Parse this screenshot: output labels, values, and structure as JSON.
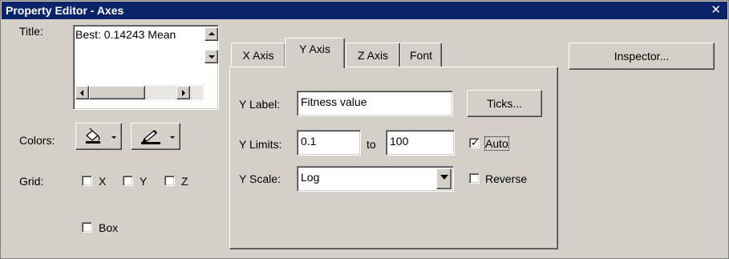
{
  "window": {
    "title": "Property Editor - Axes",
    "close_glyph": "✕",
    "titlebar_color": "#0a246a"
  },
  "left": {
    "title_label": "Title:",
    "title_value": "Best: 0.14243 Mean",
    "colors_label": "Colors:",
    "fill_color_icon": "paint-bucket-icon",
    "edge_color_icon": "pen-icon",
    "grid_label": "Grid:",
    "grid_options": [
      {
        "label": "X",
        "checked": false
      },
      {
        "label": "Y",
        "checked": false
      },
      {
        "label": "Z",
        "checked": false
      }
    ],
    "box": {
      "label": "Box",
      "checked": false
    }
  },
  "tabs": [
    {
      "label": "X Axis",
      "active": false
    },
    {
      "label": "Y Axis",
      "active": true
    },
    {
      "label": "Z Axis",
      "active": false
    },
    {
      "label": "Font",
      "active": false
    }
  ],
  "panel": {
    "ylabel_label": "Y Label:",
    "ylabel_value": "Fitness value",
    "ticks_button": "Ticks...",
    "ylimits_label": "Y Limits:",
    "ylimit_min": "0.1",
    "to_label": "to",
    "ylimit_max": "100",
    "auto": {
      "label": "Auto",
      "checked": true
    },
    "yscale_label": "Y Scale:",
    "yscale_value": "Log",
    "reverse": {
      "label": "Reverse",
      "checked": false
    }
  },
  "inspector_button": "Inspector..."
}
